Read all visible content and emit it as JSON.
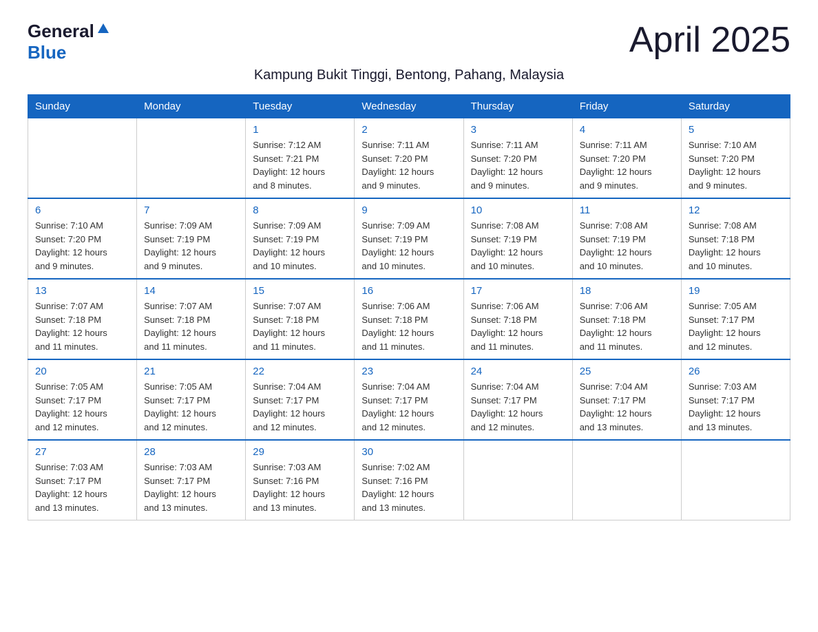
{
  "header": {
    "logo_general": "General",
    "logo_blue": "Blue",
    "month_title": "April 2025",
    "location": "Kampung Bukit Tinggi, Bentong, Pahang, Malaysia"
  },
  "weekdays": [
    "Sunday",
    "Monday",
    "Tuesday",
    "Wednesday",
    "Thursday",
    "Friday",
    "Saturday"
  ],
  "weeks": [
    [
      {
        "day": "",
        "info": ""
      },
      {
        "day": "",
        "info": ""
      },
      {
        "day": "1",
        "info": "Sunrise: 7:12 AM\nSunset: 7:21 PM\nDaylight: 12 hours\nand 8 minutes."
      },
      {
        "day": "2",
        "info": "Sunrise: 7:11 AM\nSunset: 7:20 PM\nDaylight: 12 hours\nand 9 minutes."
      },
      {
        "day": "3",
        "info": "Sunrise: 7:11 AM\nSunset: 7:20 PM\nDaylight: 12 hours\nand 9 minutes."
      },
      {
        "day": "4",
        "info": "Sunrise: 7:11 AM\nSunset: 7:20 PM\nDaylight: 12 hours\nand 9 minutes."
      },
      {
        "day": "5",
        "info": "Sunrise: 7:10 AM\nSunset: 7:20 PM\nDaylight: 12 hours\nand 9 minutes."
      }
    ],
    [
      {
        "day": "6",
        "info": "Sunrise: 7:10 AM\nSunset: 7:20 PM\nDaylight: 12 hours\nand 9 minutes."
      },
      {
        "day": "7",
        "info": "Sunrise: 7:09 AM\nSunset: 7:19 PM\nDaylight: 12 hours\nand 9 minutes."
      },
      {
        "day": "8",
        "info": "Sunrise: 7:09 AM\nSunset: 7:19 PM\nDaylight: 12 hours\nand 10 minutes."
      },
      {
        "day": "9",
        "info": "Sunrise: 7:09 AM\nSunset: 7:19 PM\nDaylight: 12 hours\nand 10 minutes."
      },
      {
        "day": "10",
        "info": "Sunrise: 7:08 AM\nSunset: 7:19 PM\nDaylight: 12 hours\nand 10 minutes."
      },
      {
        "day": "11",
        "info": "Sunrise: 7:08 AM\nSunset: 7:19 PM\nDaylight: 12 hours\nand 10 minutes."
      },
      {
        "day": "12",
        "info": "Sunrise: 7:08 AM\nSunset: 7:18 PM\nDaylight: 12 hours\nand 10 minutes."
      }
    ],
    [
      {
        "day": "13",
        "info": "Sunrise: 7:07 AM\nSunset: 7:18 PM\nDaylight: 12 hours\nand 11 minutes."
      },
      {
        "day": "14",
        "info": "Sunrise: 7:07 AM\nSunset: 7:18 PM\nDaylight: 12 hours\nand 11 minutes."
      },
      {
        "day": "15",
        "info": "Sunrise: 7:07 AM\nSunset: 7:18 PM\nDaylight: 12 hours\nand 11 minutes."
      },
      {
        "day": "16",
        "info": "Sunrise: 7:06 AM\nSunset: 7:18 PM\nDaylight: 12 hours\nand 11 minutes."
      },
      {
        "day": "17",
        "info": "Sunrise: 7:06 AM\nSunset: 7:18 PM\nDaylight: 12 hours\nand 11 minutes."
      },
      {
        "day": "18",
        "info": "Sunrise: 7:06 AM\nSunset: 7:18 PM\nDaylight: 12 hours\nand 11 minutes."
      },
      {
        "day": "19",
        "info": "Sunrise: 7:05 AM\nSunset: 7:17 PM\nDaylight: 12 hours\nand 12 minutes."
      }
    ],
    [
      {
        "day": "20",
        "info": "Sunrise: 7:05 AM\nSunset: 7:17 PM\nDaylight: 12 hours\nand 12 minutes."
      },
      {
        "day": "21",
        "info": "Sunrise: 7:05 AM\nSunset: 7:17 PM\nDaylight: 12 hours\nand 12 minutes."
      },
      {
        "day": "22",
        "info": "Sunrise: 7:04 AM\nSunset: 7:17 PM\nDaylight: 12 hours\nand 12 minutes."
      },
      {
        "day": "23",
        "info": "Sunrise: 7:04 AM\nSunset: 7:17 PM\nDaylight: 12 hours\nand 12 minutes."
      },
      {
        "day": "24",
        "info": "Sunrise: 7:04 AM\nSunset: 7:17 PM\nDaylight: 12 hours\nand 12 minutes."
      },
      {
        "day": "25",
        "info": "Sunrise: 7:04 AM\nSunset: 7:17 PM\nDaylight: 12 hours\nand 13 minutes."
      },
      {
        "day": "26",
        "info": "Sunrise: 7:03 AM\nSunset: 7:17 PM\nDaylight: 12 hours\nand 13 minutes."
      }
    ],
    [
      {
        "day": "27",
        "info": "Sunrise: 7:03 AM\nSunset: 7:17 PM\nDaylight: 12 hours\nand 13 minutes."
      },
      {
        "day": "28",
        "info": "Sunrise: 7:03 AM\nSunset: 7:17 PM\nDaylight: 12 hours\nand 13 minutes."
      },
      {
        "day": "29",
        "info": "Sunrise: 7:03 AM\nSunset: 7:16 PM\nDaylight: 12 hours\nand 13 minutes."
      },
      {
        "day": "30",
        "info": "Sunrise: 7:02 AM\nSunset: 7:16 PM\nDaylight: 12 hours\nand 13 minutes."
      },
      {
        "day": "",
        "info": ""
      },
      {
        "day": "",
        "info": ""
      },
      {
        "day": "",
        "info": ""
      }
    ]
  ]
}
